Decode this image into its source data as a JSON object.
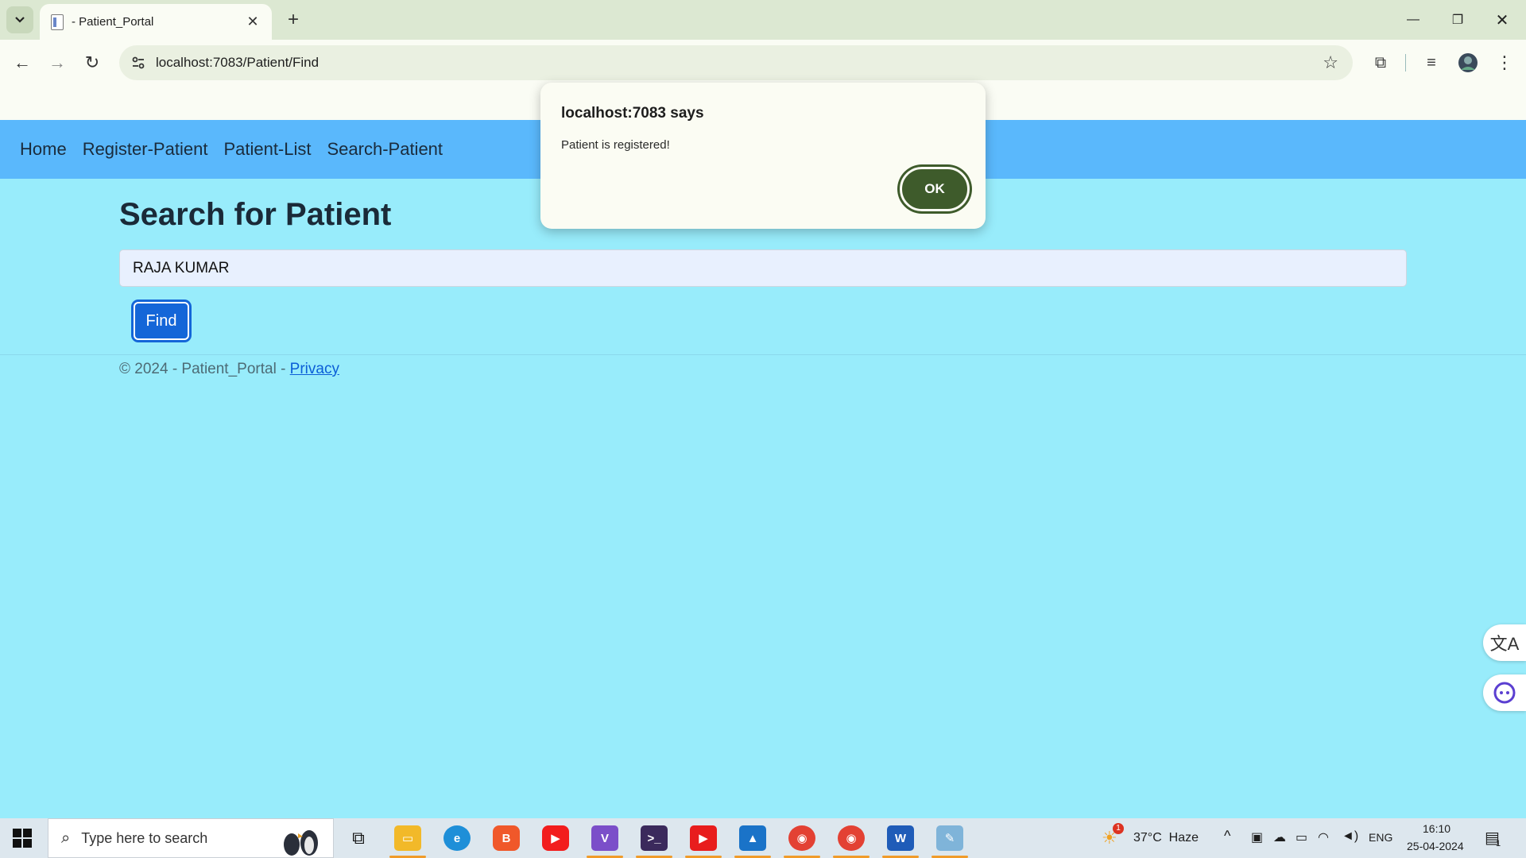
{
  "browser": {
    "tab_title": " - Patient_Portal",
    "url": "localhost:7083/Patient/Find"
  },
  "nav": {
    "items": [
      "Home",
      "Register-Patient",
      "Patient-List",
      "Search-Patient"
    ]
  },
  "page": {
    "heading": "Search for Patient",
    "search_value": "RAJA KUMAR",
    "find_label": "Find",
    "footer_text": "© 2024 - Patient_Portal - ",
    "footer_link": "Privacy"
  },
  "dialog": {
    "title": "localhost:7083 says",
    "message": "Patient is registered!",
    "ok_label": "OK"
  },
  "taskbar": {
    "search_placeholder": "Type here to search",
    "weather": "37°C  Haze",
    "weather_badge": "1",
    "language": "ENG",
    "time": "16:10",
    "date": "25-04-2024",
    "notification_count": "1"
  },
  "colors": {
    "page_bg": "#98ecfb",
    "navbar_bg": "#5ab8fc",
    "primary_button": "#1466d8",
    "dialog_ok": "#3e5b2b"
  }
}
